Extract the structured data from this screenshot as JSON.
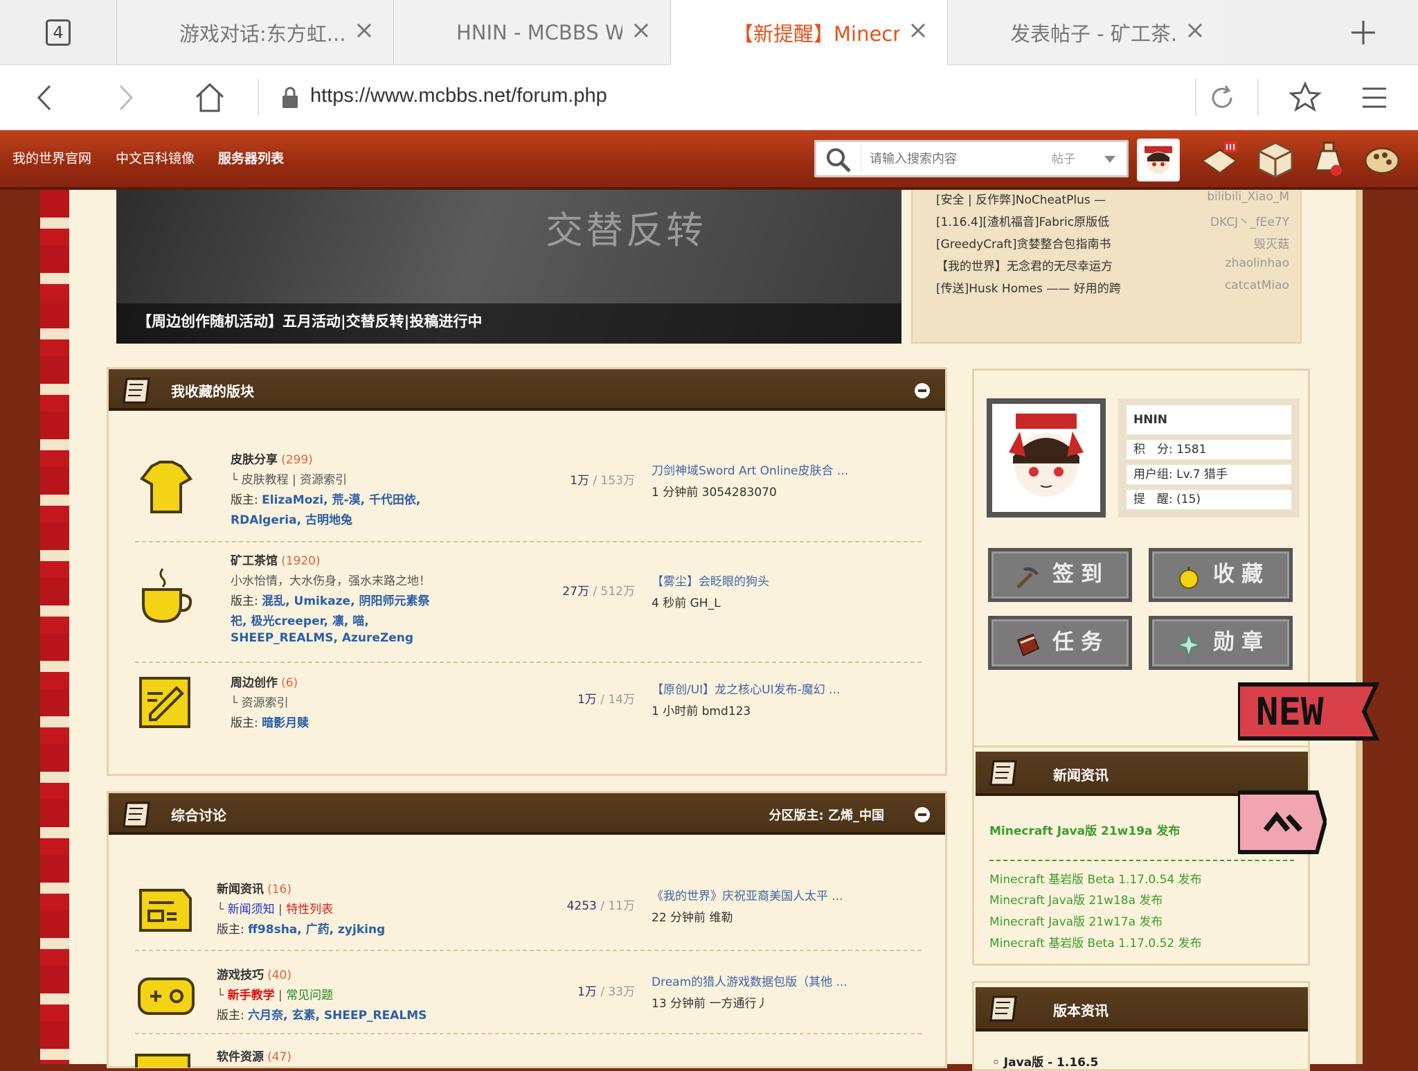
{
  "browser": {
    "tab_count": "4",
    "tabs": [
      {
        "title": "游戏对话:东方虹..."
      },
      {
        "title": "HNIN - MCBBS Wi..."
      },
      {
        "title": "【新提醒】Minecr..."
      },
      {
        "title": "发表帖子 - 矿工茶..."
      }
    ],
    "url": "https://www.mcbbs.net/forum.php"
  },
  "nav": {
    "links": [
      "我的世界官网",
      "中文百科镜像",
      "服务器列表"
    ],
    "search_placeholder": "请输入搜索内容",
    "search_type": "帖子"
  },
  "banner": {
    "title": "【周边创作随机活动】五月活动|交替反转|投稿进行中",
    "art_text": "交替反转"
  },
  "hot": [
    {
      "title": "[安全 | 反作弊]NoCheatPlus —",
      "author": "bilibili_Xiao_M"
    },
    {
      "title": "[1.16.4][渣机福音]Fabric原版低",
      "author": "DKCJ丶_fEe7Y"
    },
    {
      "title": "[GreedyCraft]贪婪整合包指南书",
      "author": "毁灭菇"
    },
    {
      "title": "【我的世界】无念君的无尽幸运方",
      "author": "zhaolinhao"
    },
    {
      "title": "[传送]Husk Homes —— 好用的跨",
      "author": "catcatMiao"
    }
  ],
  "fav": {
    "title": "我收藏的版块",
    "forums": [
      {
        "name": "皮肤分享",
        "count": "(299)",
        "sub": "└ 皮肤教程 | 资源索引",
        "mod_label": "版主: ",
        "mods1": "ElizaMozi, 荒-漠, 千代田依,",
        "mods2": "RDAlgeria, 古明地兔",
        "mods3": "",
        "stat1": "1万",
        "stat2": " / 153万",
        "last1": "刀剑神域Sword Art Online皮肤合 ...",
        "last2": "1 分钟前 3054283070"
      },
      {
        "name": "矿工茶馆",
        "count": "(1920)",
        "sub": "小水怡情，大水伤身，强水末路之地！",
        "mod_label": "版主: ",
        "mods1": "混乱, Umikaze, 阴阳师元素祭",
        "mods2": "祀, 极光creeper, 凛, 喵,",
        "mods3": "SHEEP_REALMS, AzureZeng",
        "stat1": "27万",
        "stat2": " / 512万",
        "last1": "【雾尘】会眨眼的狗头",
        "last2": "4 秒前 GH_L"
      },
      {
        "name": "周边创作",
        "count": "(6)",
        "sub": "└ 资源索引",
        "mod_label": "版主: ",
        "mods1": "暗影月赎",
        "mods2": "",
        "mods3": "",
        "stat1": "1万",
        "stat2": " / 14万",
        "last1": "【原创/UI】龙之核心UI发布-魔幻 ...",
        "last2": "1 小时前 bmd123"
      }
    ]
  },
  "general": {
    "title": "综合讨论",
    "zone_mod": "分区版主: 乙烯_中国",
    "forums": [
      {
        "name": "新闻资讯",
        "count": "(16)",
        "sub_a": "新闻须知",
        "sub_b": "特性列表",
        "mod_label": "版主: ",
        "mods": "ff98sha, 广药, zyjking",
        "stat1": "4253",
        "stat2": " / 11万",
        "last1": "《我的世界》庆祝亚裔美国人太平 ...",
        "last2": "22 分钟前 维勒"
      },
      {
        "name": "游戏技巧",
        "count": "(40)",
        "sub_a": "新手教学",
        "sub_b": "常见问题",
        "mod_label": "版主: ",
        "mods": "六月奈, 玄素, SHEEP_REALMS",
        "stat1": "1万",
        "stat2": " / 33万",
        "last1": "Dream的猎人游戏数据包版（其他 ...",
        "last2": "13 分钟前 一方通行丿"
      },
      {
        "name": "软件资源",
        "count": "(47)"
      }
    ]
  },
  "user": {
    "name": "HNIN",
    "points": "积　分: 1581",
    "group": "用户组: Lv.7 猎手",
    "remind": "提　醒: (15)",
    "buttons": [
      "签到",
      "收藏",
      "任务",
      "勋章"
    ]
  },
  "news": {
    "title": "新闻资讯",
    "featured": "Minecraft Java版 21w19a 发布",
    "badge_new": "NEW",
    "items": [
      "Minecraft 基岩版 Beta 1.17.0.54 发布",
      "Minecraft Java版 21w18a 发布",
      "Minecraft Java版 21w17a 发布",
      "Minecraft 基岩版 Beta 1.17.0.52 发布"
    ]
  },
  "versions": {
    "title": "版本资讯",
    "first": "Java版 - 1.16.5"
  },
  "colors": {
    "accent_tab": "#e2521a",
    "header_red": "#a8330f",
    "link_blue": "#2a5fa8",
    "news_green": "#3a9e2b",
    "count_orange": "#d8643e"
  }
}
